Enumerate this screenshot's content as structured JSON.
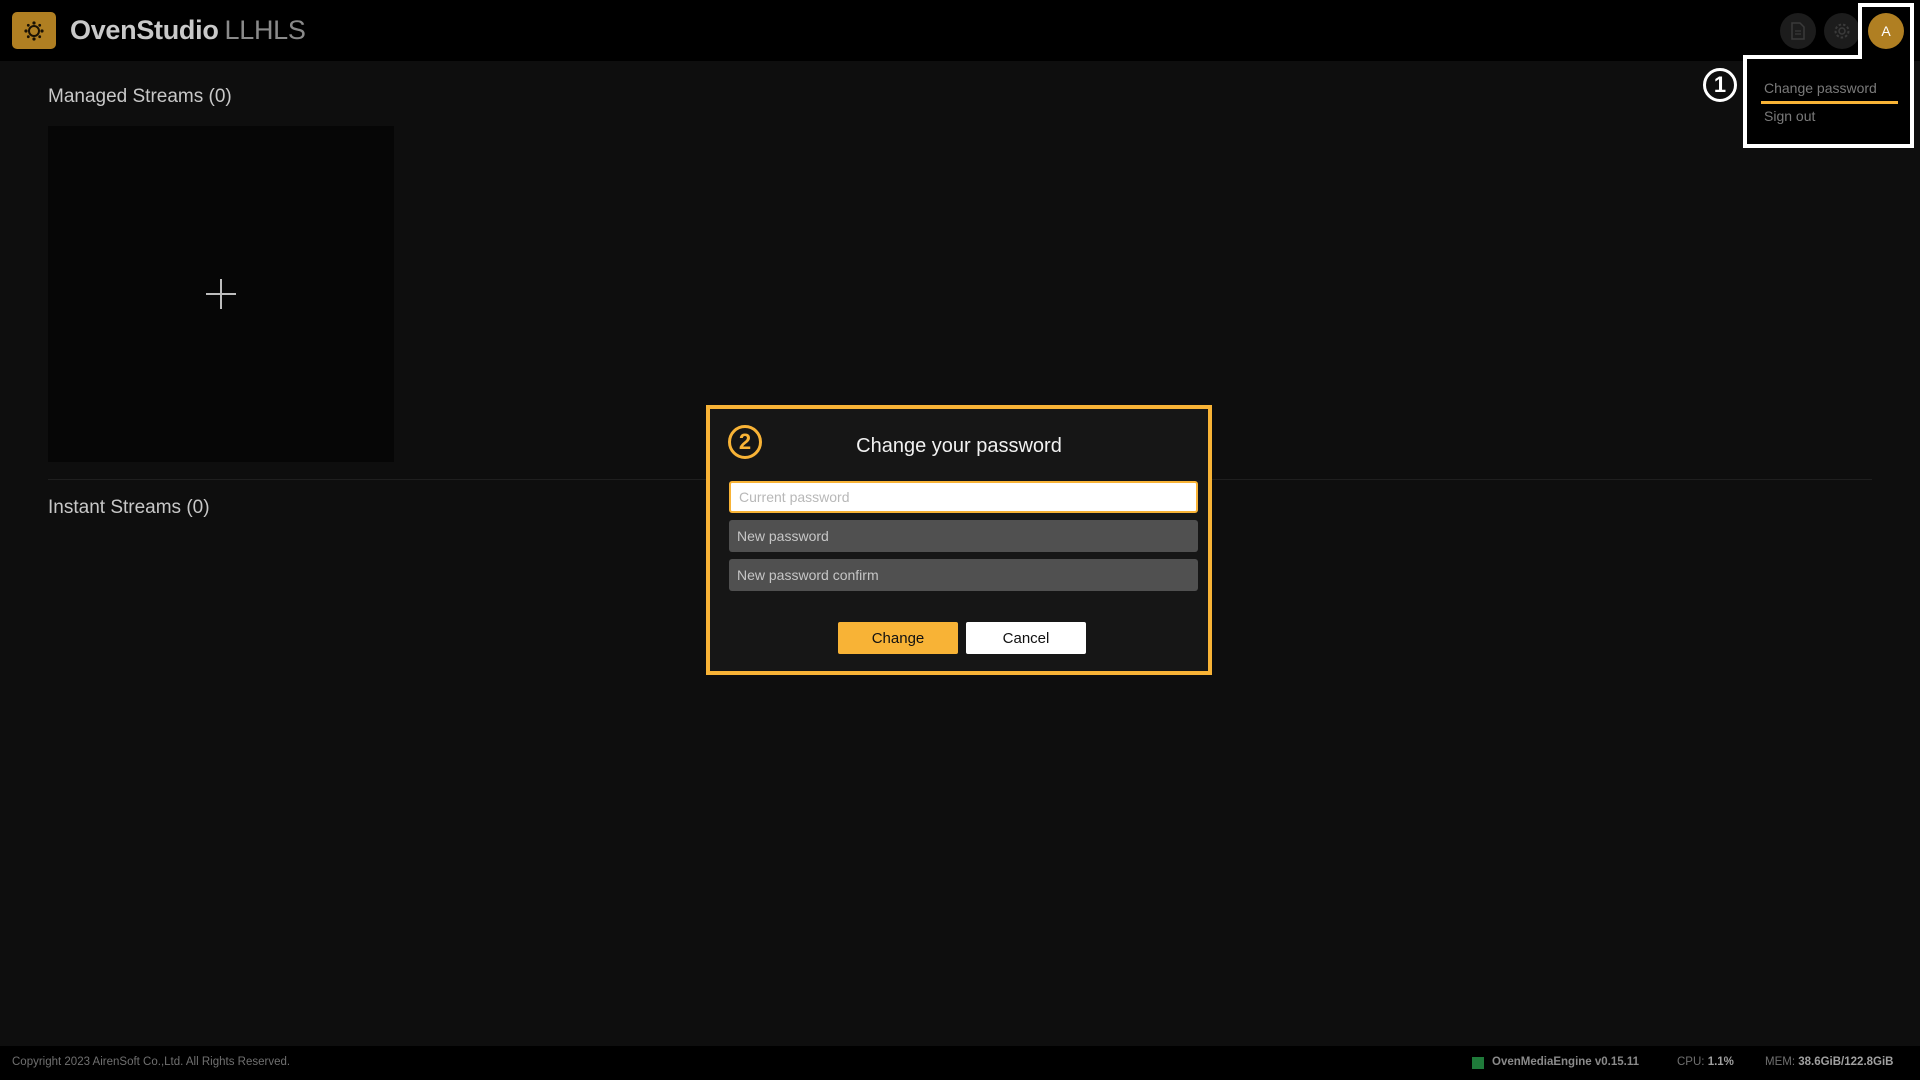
{
  "app": {
    "name": "OvenStudio",
    "edition": "LLHLS"
  },
  "header": {
    "icons": [
      "logo-icon",
      "document-icon",
      "gear-icon"
    ],
    "avatar_initial": "A",
    "user_menu": {
      "change_password": "Change password",
      "sign_out": "Sign out"
    }
  },
  "annotations": {
    "step1": "1",
    "step2": "2"
  },
  "colors": {
    "accent": "#f8b336",
    "brand": "#b07f22",
    "background": "#0e0e0e",
    "status_ok": "#1f7a3a"
  },
  "sections": {
    "managed": "Managed Streams (0)",
    "instant": "Instant Streams (0)"
  },
  "add_card": {
    "icon": "plus-icon"
  },
  "modal": {
    "title": "Change your password",
    "fields": {
      "current": {
        "value": "",
        "placeholder": "Current password"
      },
      "new": {
        "value": "",
        "placeholder": "New password"
      },
      "confirm": {
        "value": "",
        "placeholder": "New password confirm"
      }
    },
    "buttons": {
      "change": "Change",
      "cancel": "Cancel"
    }
  },
  "footer": {
    "copyright": "Copyright 2023 AirenSoft Co.,Ltd. All Rights Reserved.",
    "engine": "OvenMediaEngine v0.15.11",
    "cpu_label": "CPU:",
    "cpu_value": "1.1%",
    "mem_label": "MEM:",
    "mem_value": "38.6GiB/122.8GiB"
  }
}
